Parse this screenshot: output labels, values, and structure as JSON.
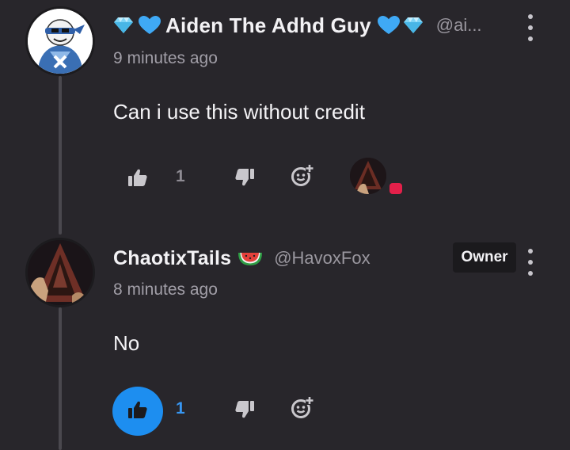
{
  "comments": [
    {
      "display_name": "Aiden The Adhd Guy",
      "handle": "@ai...",
      "timestamp": "9 minutes ago",
      "text": "Can i use this without credit",
      "likes": "1",
      "liked": false,
      "badge": "",
      "decorations": [
        "diamond-icon",
        "blue-heart-icon",
        "blue-heart-icon",
        "diamond-icon"
      ]
    },
    {
      "display_name": "ChaotixTails",
      "handle": "@HavoxFox",
      "timestamp": "8 minutes ago",
      "text": "No",
      "likes": "1",
      "liked": true,
      "badge": "Owner",
      "decorations": [
        "watermelon-icon"
      ]
    }
  ],
  "colors": {
    "background": "#28262b",
    "accent_blue": "#1d8ef0",
    "reaction_badge": "#e3204a"
  }
}
